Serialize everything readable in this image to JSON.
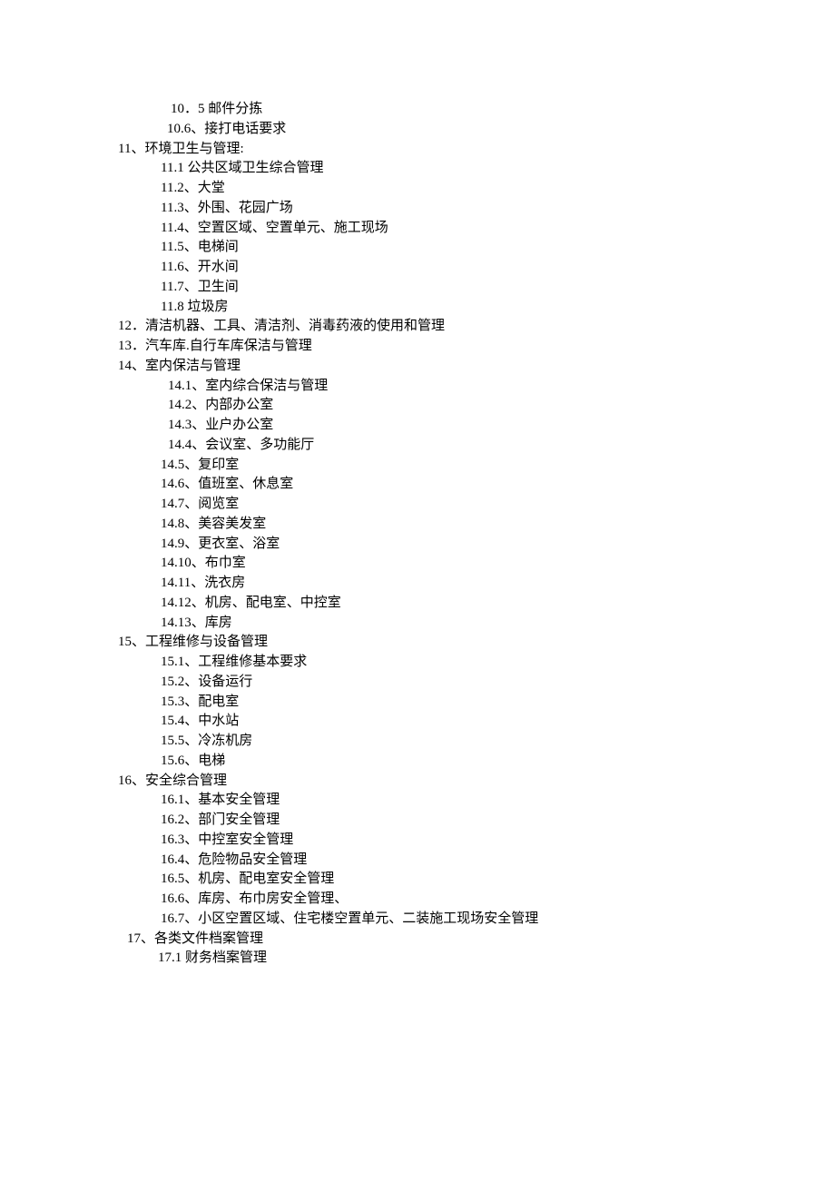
{
  "lines": [
    {
      "cls": "indent-00",
      "text": "10．5 邮件分拣"
    },
    {
      "cls": "indent-0",
      "text": "10.6、接打电话要求"
    },
    {
      "cls": "indent-1",
      "text": "11、环境卫生与管理:"
    },
    {
      "cls": "indent-2",
      "text": "11.1 公共区域卫生综合管理"
    },
    {
      "cls": "indent-2",
      "text": "11.2、大堂"
    },
    {
      "cls": "indent-2",
      "text": "11.3、外围、花园广场"
    },
    {
      "cls": "indent-2",
      "text": "11.4、空置区域、空置单元、施工现场"
    },
    {
      "cls": "indent-2",
      "text": "11.5、电梯间"
    },
    {
      "cls": "indent-2",
      "text": "11.6、开水间"
    },
    {
      "cls": "indent-2",
      "text": "11.7、卫生间"
    },
    {
      "cls": "indent-2",
      "text": "11.8 垃圾房"
    },
    {
      "cls": "indent-1",
      "text": "12．清洁机器、工具、清洁剂、消毒药液的使用和管理"
    },
    {
      "cls": "indent-1",
      "text": "13．汽车库.自行车库保洁与管理"
    },
    {
      "cls": "indent-1",
      "text": "14、室内保洁与管理"
    },
    {
      "cls": "indent-3",
      "text": "14.1、室内综合保洁与管理"
    },
    {
      "cls": "indent-3",
      "text": "14.2、内部办公室"
    },
    {
      "cls": "indent-3",
      "text": "14.3、业户办公室"
    },
    {
      "cls": "indent-3",
      "text": "14.4、会议室、多功能厅"
    },
    {
      "cls": "indent-3b",
      "text": "14.5、复印室"
    },
    {
      "cls": "indent-3b",
      "text": "14.6、值班室、休息室"
    },
    {
      "cls": "indent-3b",
      "text": "14.7、阅览室"
    },
    {
      "cls": "indent-3b",
      "text": "14.8、美容美发室"
    },
    {
      "cls": "indent-3b",
      "text": "14.9、更衣室、浴室"
    },
    {
      "cls": "indent-3b",
      "text": "14.10、布巾室"
    },
    {
      "cls": "indent-3b",
      "text": "14.11、洗衣房"
    },
    {
      "cls": "indent-3b",
      "text": "14.12、机房、配电室、中控室"
    },
    {
      "cls": "indent-3b",
      "text": "14.13、库房"
    },
    {
      "cls": "indent-1",
      "text": "15、工程维修与设备管理"
    },
    {
      "cls": "indent-2",
      "text": "15.1、工程维修基本要求"
    },
    {
      "cls": "indent-2",
      "text": "15.2、设备运行"
    },
    {
      "cls": "indent-2",
      "text": "15.3、配电室"
    },
    {
      "cls": "indent-2",
      "text": "15.4、中水站"
    },
    {
      "cls": "indent-2",
      "text": "15.5、冷冻机房"
    },
    {
      "cls": "indent-2",
      "text": "15.6、电梯"
    },
    {
      "cls": "indent-1",
      "text": "16、安全综合管理"
    },
    {
      "cls": "indent-2",
      "text": "16.1、基本安全管理"
    },
    {
      "cls": "indent-2",
      "text": "16.2、部门安全管理"
    },
    {
      "cls": "indent-2",
      "text": "16.3、中控室安全管理"
    },
    {
      "cls": "indent-2",
      "text": "16.4、危险物品安全管理"
    },
    {
      "cls": "indent-2",
      "text": "16.5、机房、配电室安全管理"
    },
    {
      "cls": "indent-2",
      "text": "16.6、库房、布巾房安全管理、"
    },
    {
      "cls": "indent-2",
      "text": "16.7、小区空置区域、住宅楼空置单元、二装施工现场安全管理"
    },
    {
      "cls": "indent-4",
      "text": "17、各类文件档案管理"
    },
    {
      "cls": "indent-5",
      "text": "17.1 财务档案管理"
    }
  ]
}
